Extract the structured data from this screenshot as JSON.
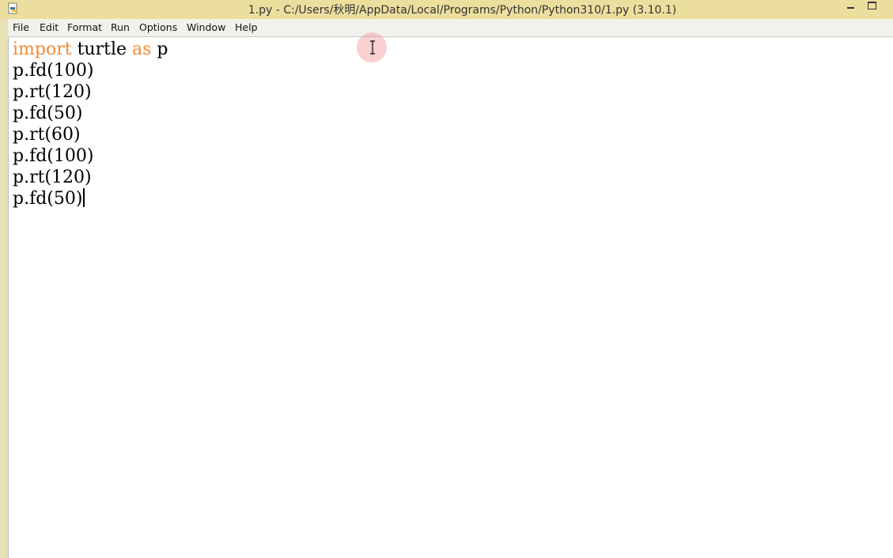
{
  "window": {
    "title": "1.py - C:/Users/秋明/AppData/Local/Programs/Python/Python310/1.py (3.10.1)"
  },
  "menubar": {
    "items": [
      {
        "label": "File"
      },
      {
        "label": "Edit"
      },
      {
        "label": "Format"
      },
      {
        "label": "Run"
      },
      {
        "label": "Options"
      },
      {
        "label": "Window"
      },
      {
        "label": "Help"
      }
    ]
  },
  "editor": {
    "lines": [
      [
        {
          "text": "import",
          "kind": "keyword"
        },
        {
          "text": " turtle ",
          "kind": "plain"
        },
        {
          "text": "as",
          "kind": "keyword"
        },
        {
          "text": " p",
          "kind": "plain"
        }
      ],
      [
        {
          "text": "p.fd(100)",
          "kind": "plain"
        }
      ],
      [
        {
          "text": "p.rt(120)",
          "kind": "plain"
        }
      ],
      [
        {
          "text": "p.fd(50)",
          "kind": "plain"
        }
      ],
      [
        {
          "text": "p.rt(60)",
          "kind": "plain"
        }
      ],
      [
        {
          "text": "p.fd(100)",
          "kind": "plain"
        }
      ],
      [
        {
          "text": "p.rt(120)",
          "kind": "plain"
        }
      ],
      [
        {
          "text": "p.fd(50)",
          "kind": "plain"
        }
      ]
    ],
    "keyword_color": "#f08b35",
    "text_color": "#000000",
    "caret_line": 8
  },
  "icons": {
    "app": "python-idle-icon",
    "minimize": "minimize-icon",
    "maximize": "maximize-icon",
    "mouse_cursor": "ibeam-cursor-icon"
  }
}
